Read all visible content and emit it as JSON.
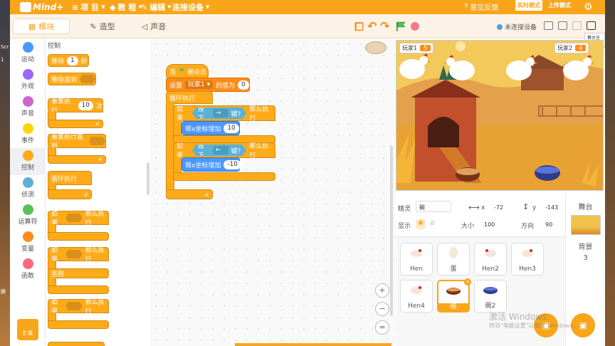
{
  "menubar": {
    "logo_text": "Mind+",
    "items": [
      {
        "label": "项 目"
      },
      {
        "label": "教 程"
      },
      {
        "label": "编辑"
      },
      {
        "label": "连接设备"
      }
    ],
    "feedback": "意见反馈",
    "realtime_mode": "实时模式",
    "upload_mode": "上传模式"
  },
  "tabs": [
    {
      "label": "模块"
    },
    {
      "label": "造型"
    },
    {
      "label": "声音"
    }
  ],
  "toolbar": {
    "device_status": "未连接设备",
    "fullscreen_tip": "舞台全屏"
  },
  "categories": [
    {
      "label": "运动",
      "color": "#4c97ff"
    },
    {
      "label": "外观",
      "color": "#9966ff"
    },
    {
      "label": "声音",
      "color": "#cf63cf"
    },
    {
      "label": "事件",
      "color": "#ffd500"
    },
    {
      "label": "控制",
      "color": "#ffab19"
    },
    {
      "label": "侦测",
      "color": "#5cb1d6"
    },
    {
      "label": "运算符",
      "color": "#59c059"
    },
    {
      "label": "变量",
      "color": "#ff8c1a"
    },
    {
      "label": "函数",
      "color": "#ff6680"
    }
  ],
  "extensions_label": "扩展",
  "palette": {
    "title": "控制",
    "wait_label": "等待",
    "wait_value": "1",
    "wait_unit": "秒",
    "wait_until": "等待直到",
    "repeat_label": "重复执行",
    "repeat_value": "10",
    "repeat_unit": "次",
    "repeat_until": "重复执行直到",
    "forever": "循环执行",
    "if_label": "如果",
    "then_label": "那么执行",
    "else_label": "否则"
  },
  "script": {
    "hat_prefix": "当",
    "hat_suffix": "被点击",
    "set_label": "设置",
    "set_var": "玩家1",
    "set_mid": "的值为",
    "set_value": "0",
    "forever": "循环执行",
    "if_label": "如果",
    "press_label": "按下",
    "key_right": "→",
    "key_left": "←",
    "key_suffix": "键?",
    "then_label": "那么执行",
    "change_x_label": "将x坐标增加",
    "change_x_right": "10",
    "change_x_left": "-10"
  },
  "stage": {
    "player1_label": "玩家1",
    "player1_value": "5",
    "player2_label": "玩家2",
    "player2_value": "4"
  },
  "sprite_info": {
    "sprite_label": "精灵",
    "sprite_name": "碗",
    "x_label": "x",
    "x_value": "-72",
    "y_label": "y",
    "y_value": "-143",
    "show_label": "显示",
    "size_label": "大小",
    "size_value": "100",
    "direction_label": "方向",
    "direction_value": "90"
  },
  "sprites": [
    {
      "name": "Hen"
    },
    {
      "name": "蛋"
    },
    {
      "name": "Hen2"
    },
    {
      "name": "Hen3"
    },
    {
      "name": "Hen4"
    },
    {
      "name": "碗"
    },
    {
      "name": "碗2"
    }
  ],
  "stage_panel": {
    "title": "舞台",
    "backdrop_label": "背景",
    "backdrop_count": "3"
  },
  "watermark": {
    "line1": "激活 Windows",
    "line2": "转到\"电脑设置\"以激活 Windows。"
  }
}
